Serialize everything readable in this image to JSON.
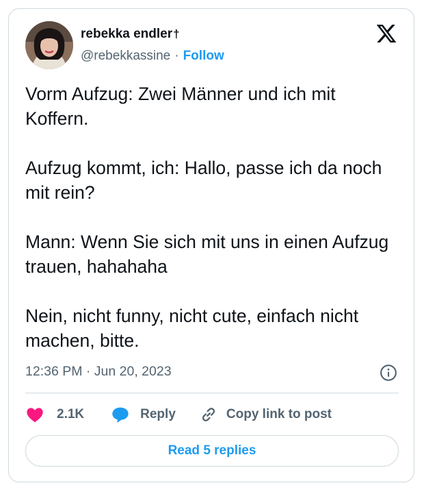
{
  "author": {
    "display_name": "rebekka endler",
    "name_glyph": "†",
    "handle": "@rebekkassine",
    "separator": "·",
    "follow_label": "Follow"
  },
  "tweet": {
    "paragraphs": [
      "Vorm Aufzug: Zwei Männer und ich mit Koffern.",
      "Aufzug kommt, ich: Hallo, passe ich da noch mit rein?",
      "Mann: Wenn Sie sich mit uns in einen Aufzug trauen, hahahaha",
      "Nein, nicht funny, nicht cute, einfach nicht machen, bitte."
    ],
    "timestamp": "12:36 PM · Jun 20, 2023"
  },
  "actions": {
    "likes_count": "2.1K",
    "reply_label": "Reply",
    "copy_link_label": "Copy link to post"
  },
  "footer": {
    "read_replies_label": "Read 5 replies"
  },
  "icons": {
    "like": "heart-icon",
    "reply": "speech-bubble-icon",
    "copy": "link-icon",
    "info": "info-icon",
    "brand": "x-logo-icon"
  },
  "colors": {
    "accent": "#1d9bf0",
    "like": "#f91880",
    "muted": "#536471",
    "text": "#0f1419",
    "border": "#cfd9de"
  }
}
